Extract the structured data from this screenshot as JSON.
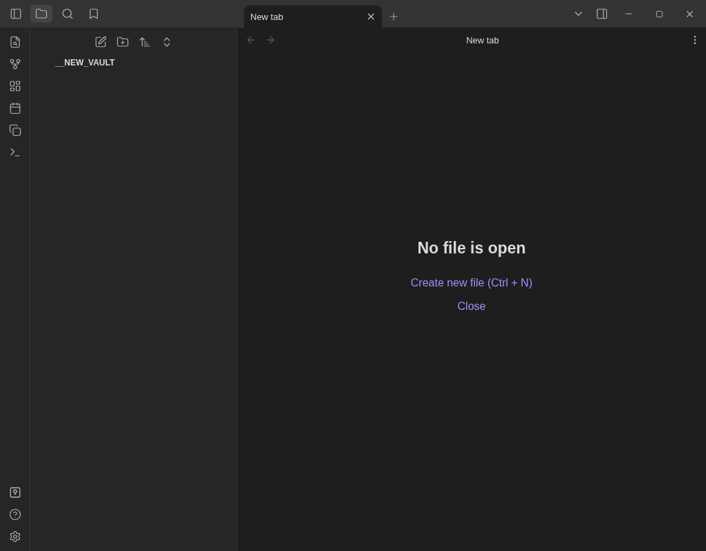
{
  "sidebar_tabs": [
    {
      "kind": "files",
      "selected": true
    },
    {
      "kind": "search",
      "selected": false
    },
    {
      "kind": "bookmarks",
      "selected": false
    }
  ],
  "tabs": [
    {
      "label": "New tab",
      "selected": true
    }
  ],
  "file_explorer": {
    "vault_name": "__NEW_VAULT"
  },
  "view_header": {
    "title": "New tab"
  },
  "empty_state": {
    "title": "No file is open",
    "actions": [
      "Create new file (Ctrl + N)",
      "Close"
    ]
  }
}
